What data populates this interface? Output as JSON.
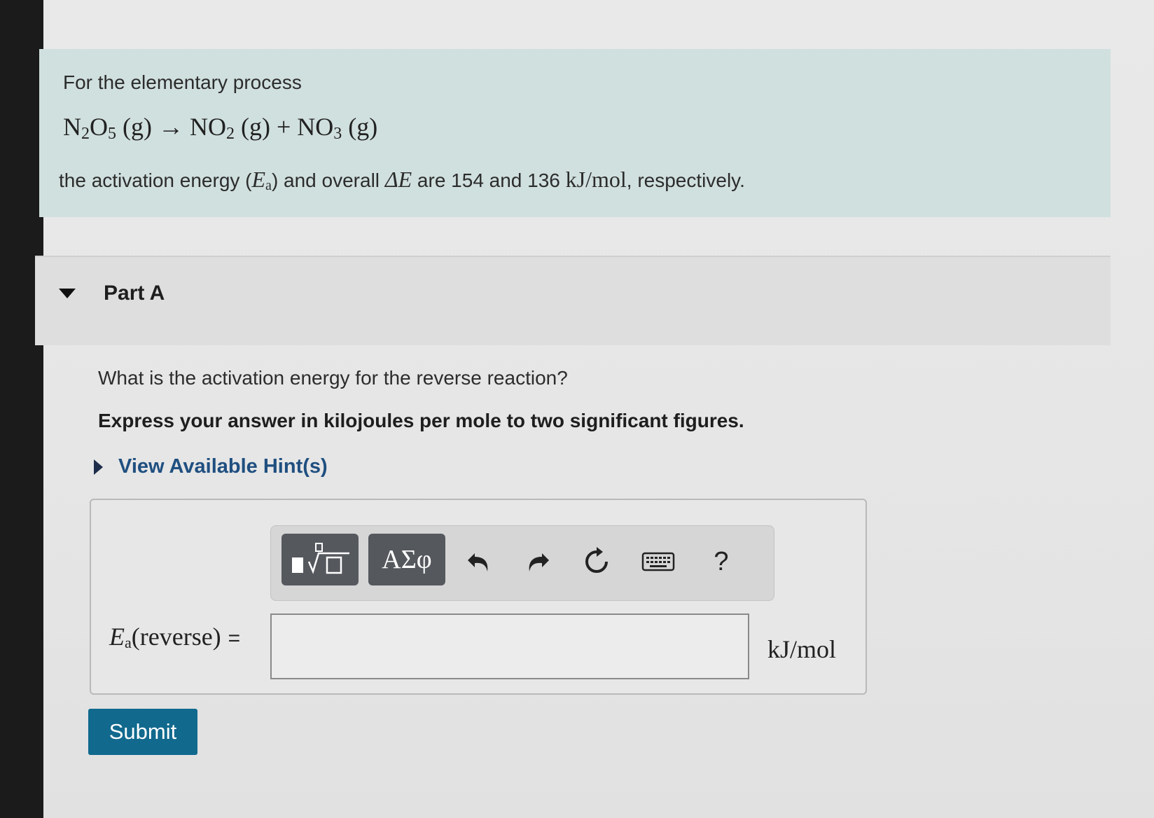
{
  "problem": {
    "intro": "For the elementary process",
    "equation": {
      "reactant": "N",
      "reactant_sub1": "2",
      "reactant_mid": "O",
      "reactant_sub2": "5",
      "reactant_state": "(g)",
      "arrow": "→",
      "product1": "NO",
      "product1_sub": "2",
      "product1_state": "(g)",
      "plus": "+",
      "product2": "NO",
      "product2_sub": "3",
      "product2_state": "(g)"
    },
    "statement_prefix": "the activation energy (",
    "ea_symbol": "E",
    "ea_sub": "a",
    "statement_mid": ") and overall ",
    "delta_e": "ΔE",
    "statement_mid2": " are 154 and 136 ",
    "unit": "kJ/mol",
    "statement_suffix": ", respectively."
  },
  "part": {
    "title": "Part A",
    "question": "What is the activation energy for the reverse reaction?",
    "instruction": "Express your answer in kilojoules per mole to two significant figures.",
    "hint_label": "View Available Hint(s)"
  },
  "answer": {
    "label_symbol": "E",
    "label_sub": "a",
    "label_arg": "(reverse)",
    "equals": "=",
    "value": "",
    "unit": "kJ/mol"
  },
  "toolbar": {
    "symbols_label": "ΑΣφ",
    "help_label": "?"
  },
  "submit_label": "Submit",
  "colors": {
    "intro_bg": "#d0e0de",
    "submit_bg": "#11698e",
    "hint_text": "#1f4f80",
    "toolbar_btn": "#55595e"
  }
}
